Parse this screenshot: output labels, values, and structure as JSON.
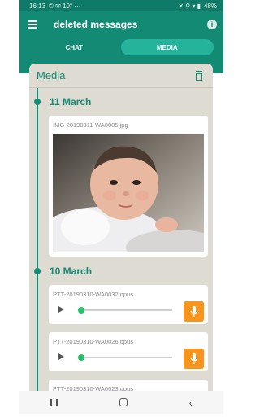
{
  "status": {
    "time": "16:13",
    "left_icons": "© ✉ 10° ···",
    "right_icons": "✕ ⚲ ▾ ▮",
    "battery": "48%"
  },
  "appbar": {
    "title": "deleted messages",
    "menu_icon": "menu-icon",
    "info_icon": "info-icon"
  },
  "tabs": [
    {
      "label": "CHAT",
      "active": false
    },
    {
      "label": "MEDIA",
      "active": true
    }
  ],
  "media": {
    "title": "Media",
    "delete_icon": "trash-icon",
    "groups": [
      {
        "date": "11 March",
        "items": [
          {
            "type": "image",
            "name": "IMG-20190311-WA0005.jpg",
            "content": "photo of a baby"
          }
        ]
      },
      {
        "date": "10 March",
        "items": [
          {
            "type": "audio",
            "name": "PTT-20190310-WA0032.opus",
            "progress": 0
          },
          {
            "type": "audio",
            "name": "PTT-20190310-WA0026.opus",
            "progress": 0
          },
          {
            "type": "audio",
            "name": "PTT-20190310-WA0023.opus",
            "progress": 0
          }
        ]
      }
    ]
  },
  "navbar": {
    "recents_icon": "recents-icon",
    "home_icon": "home-icon",
    "back_icon": "back-icon",
    "back_glyph": "‹"
  },
  "colors": {
    "primary": "#138a74",
    "tab_active": "#25b39c",
    "accent_orange": "#f7941d",
    "progress_green": "#21c46b",
    "card_bg": "#dedbd3"
  }
}
